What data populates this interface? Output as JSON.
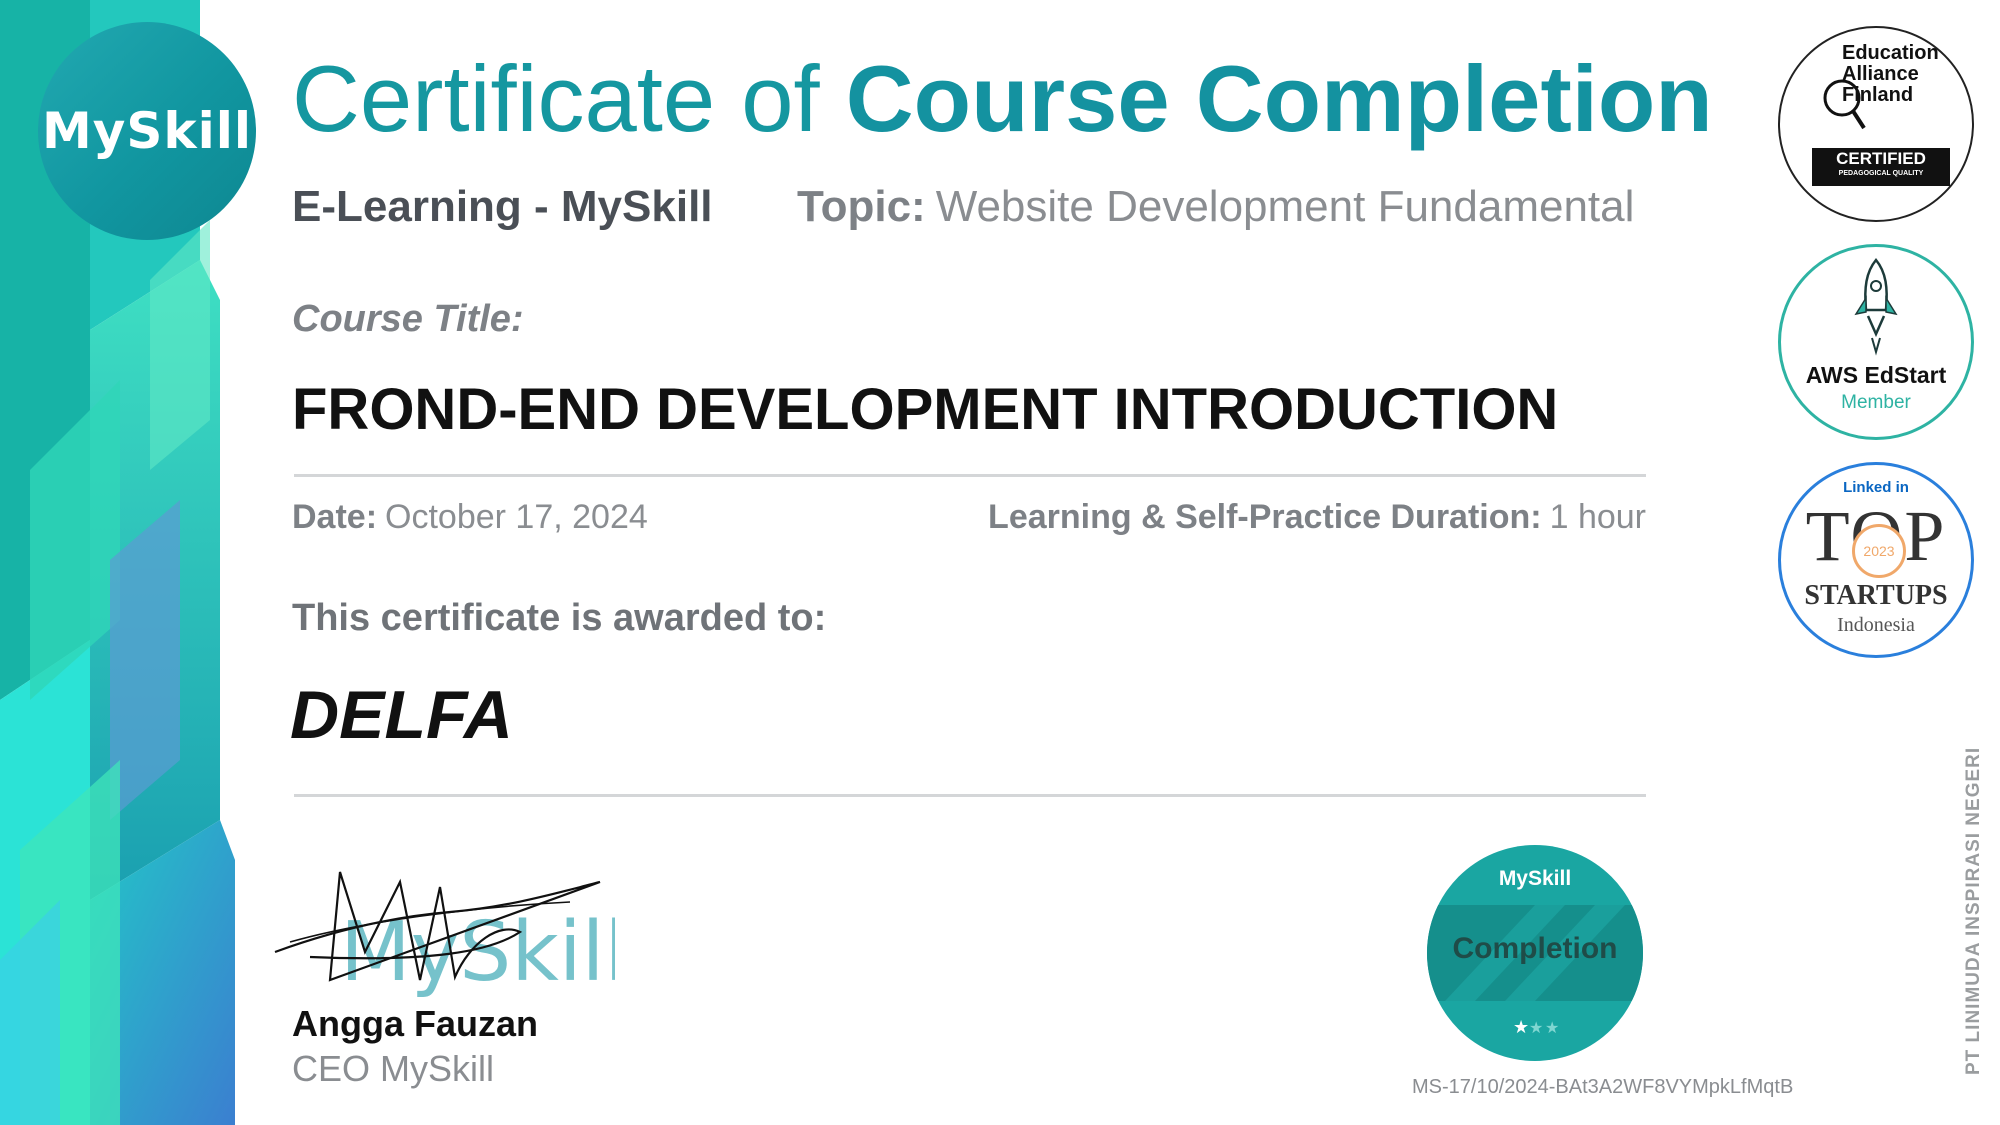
{
  "brand": {
    "logo_text": "MySkill"
  },
  "header": {
    "title_prefix": "Certificate of ",
    "title_emphasis": "Course Completion",
    "provider": "E-Learning - MySkill",
    "topic_label": "Topic:",
    "topic_value": "Website Development Fundamental"
  },
  "course": {
    "title_label": "Course Title:",
    "title": "FROND-END DEVELOPMENT INTRODUCTION"
  },
  "meta": {
    "date_label": "Date:",
    "date_value": "October 17, 2024",
    "duration_label": "Learning & Self-Practice Duration:",
    "duration_value": "1 hour"
  },
  "award": {
    "awarded_label": "This certificate is awarded to:",
    "recipient": "DELFA"
  },
  "signatory": {
    "name": "Angga Fauzan",
    "role": "CEO MySkill",
    "signature_watermark": "MySkill"
  },
  "badges": {
    "eaf_line1": "Education",
    "eaf_line2": "Alliance",
    "eaf_line3": "Finland",
    "eaf_certified": "CERTIFIED",
    "eaf_quality": "PEDAGOGICAL QUALITY",
    "aws_name": "AWS EdStart",
    "aws_sub": "Member",
    "linkedin": "Linked in",
    "top": "TOP",
    "year": "2023",
    "startups": "STARTUPS",
    "country": "Indonesia"
  },
  "seal": {
    "brand": "MySkill",
    "label": "Completion",
    "stars": 3
  },
  "footer": {
    "certificate_id": "MS-17/10/2024-BAt3A2WF8VYMpkLfMqtB",
    "company_vertical": "PT LINIMUDA INSPIRASI NEGERI"
  },
  "colors": {
    "accent": "#1597a0",
    "aws": "#2eb3a3",
    "linkedin": "#0a66c2",
    "seal": "#1aa6a2"
  }
}
